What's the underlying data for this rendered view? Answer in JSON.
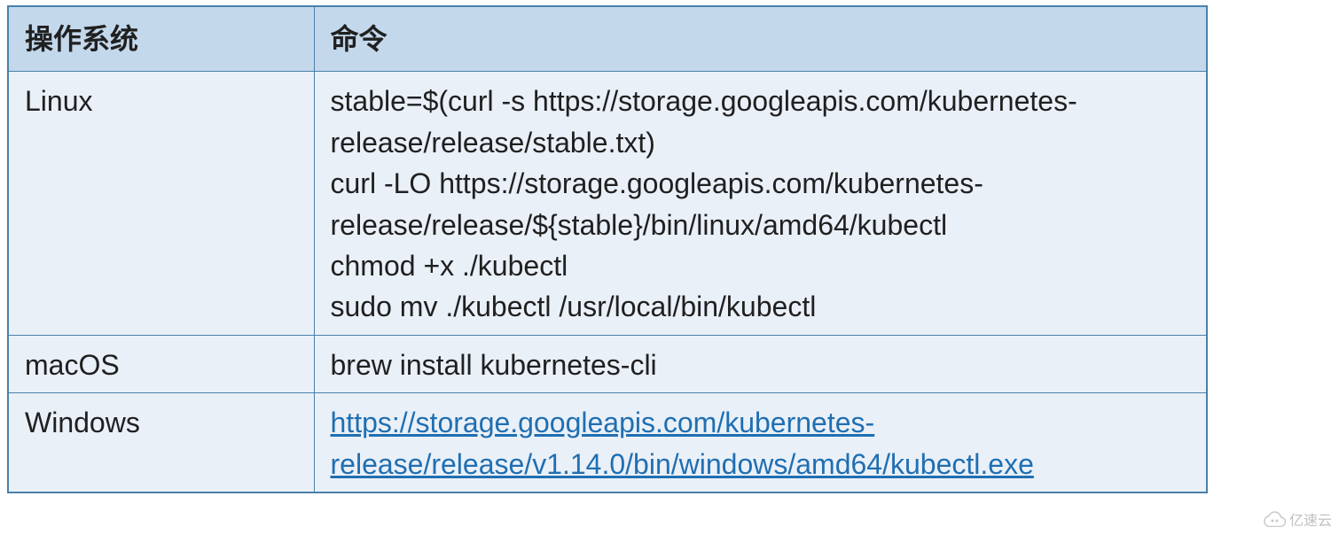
{
  "table": {
    "headers": {
      "os": "操作系统",
      "cmd": "命令"
    },
    "rows": [
      {
        "os": "Linux",
        "cmd_lines": [
          "stable=$(curl -s https://storage.googleapis.com/kubernetes-release/release/stable.txt)",
          "curl -LO https://storage.googleapis.com/kubernetes-release/release/${stable}/bin/linux/amd64/kubectl",
          "chmod +x ./kubectl",
          "sudo mv ./kubectl /usr/local/bin/kubectl"
        ]
      },
      {
        "os": "macOS",
        "cmd_lines": [
          "brew install kubernetes-cli"
        ]
      },
      {
        "os": "Windows",
        "cmd_link": "https://storage.googleapis.com/kubernetes-release/release/v1.14.0/bin/windows/amd64/kubectl.exe"
      }
    ]
  },
  "watermark": "亿速云"
}
